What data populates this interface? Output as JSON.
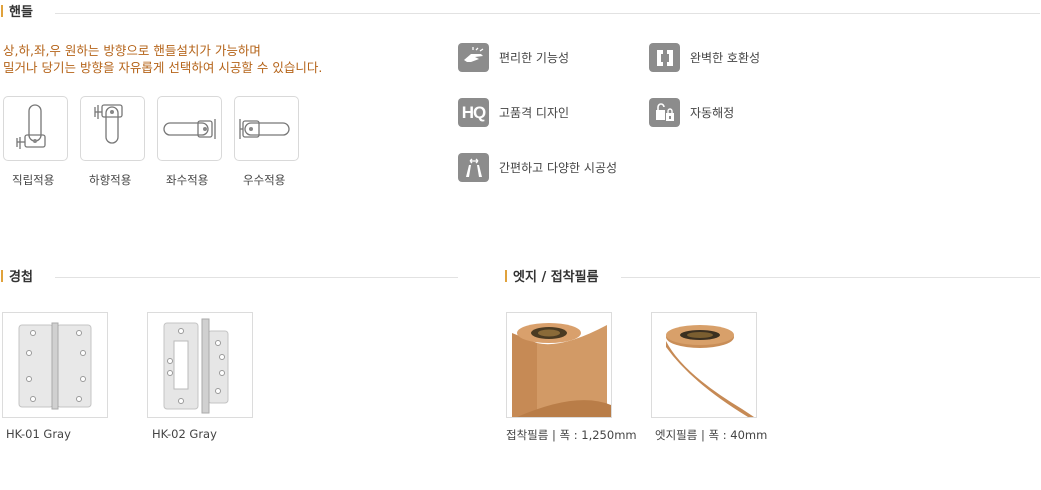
{
  "handle": {
    "title": "핸들",
    "desc_line1": "상,하,좌,우 원하는 방향으로 핸들설치가 가능하며",
    "desc_line2": "밀거나 당기는 방향을 자유롭게 선택하여 시공할 수 있습니다.",
    "items": [
      {
        "label": "직립적용",
        "icon": "handle-upright-icon"
      },
      {
        "label": "하향적용",
        "icon": "handle-down-icon"
      },
      {
        "label": "좌수적용",
        "icon": "handle-left-icon"
      },
      {
        "label": "우수적용",
        "icon": "handle-right-icon"
      }
    ],
    "features": [
      {
        "label": "편리한 기능성",
        "icon": "hand-touch-icon"
      },
      {
        "label": "완벽한 호환성",
        "icon": "compatibility-brackets-icon"
      },
      {
        "label": "고품격 디자인",
        "icon": "hq-icon",
        "icon_text": "HQ"
      },
      {
        "label": "자동해정",
        "icon": "auto-unlock-icon"
      },
      {
        "label": "간편하고 다양한 시공성",
        "icon": "installation-arrows-icon"
      }
    ]
  },
  "hinge": {
    "title": "경첩",
    "items": [
      {
        "label": "HK-01 Gray",
        "icon": "butt-hinge-image"
      },
      {
        "label": "HK-02 Gray",
        "icon": "flush-hinge-image"
      }
    ]
  },
  "edge": {
    "title": "엣지 / 접착필름",
    "items": [
      {
        "label": "접착필름 | 폭 : 1,250mm",
        "icon": "adhesive-film-roll-image"
      },
      {
        "label": "엣지필름 | 폭 : 40mm",
        "icon": "edge-film-roll-image"
      }
    ]
  },
  "colors": {
    "accent": "#e0a23c",
    "desc_text": "#b5641a",
    "icon_gray": "#8c8c8c",
    "film_brown": "#c8915f"
  }
}
